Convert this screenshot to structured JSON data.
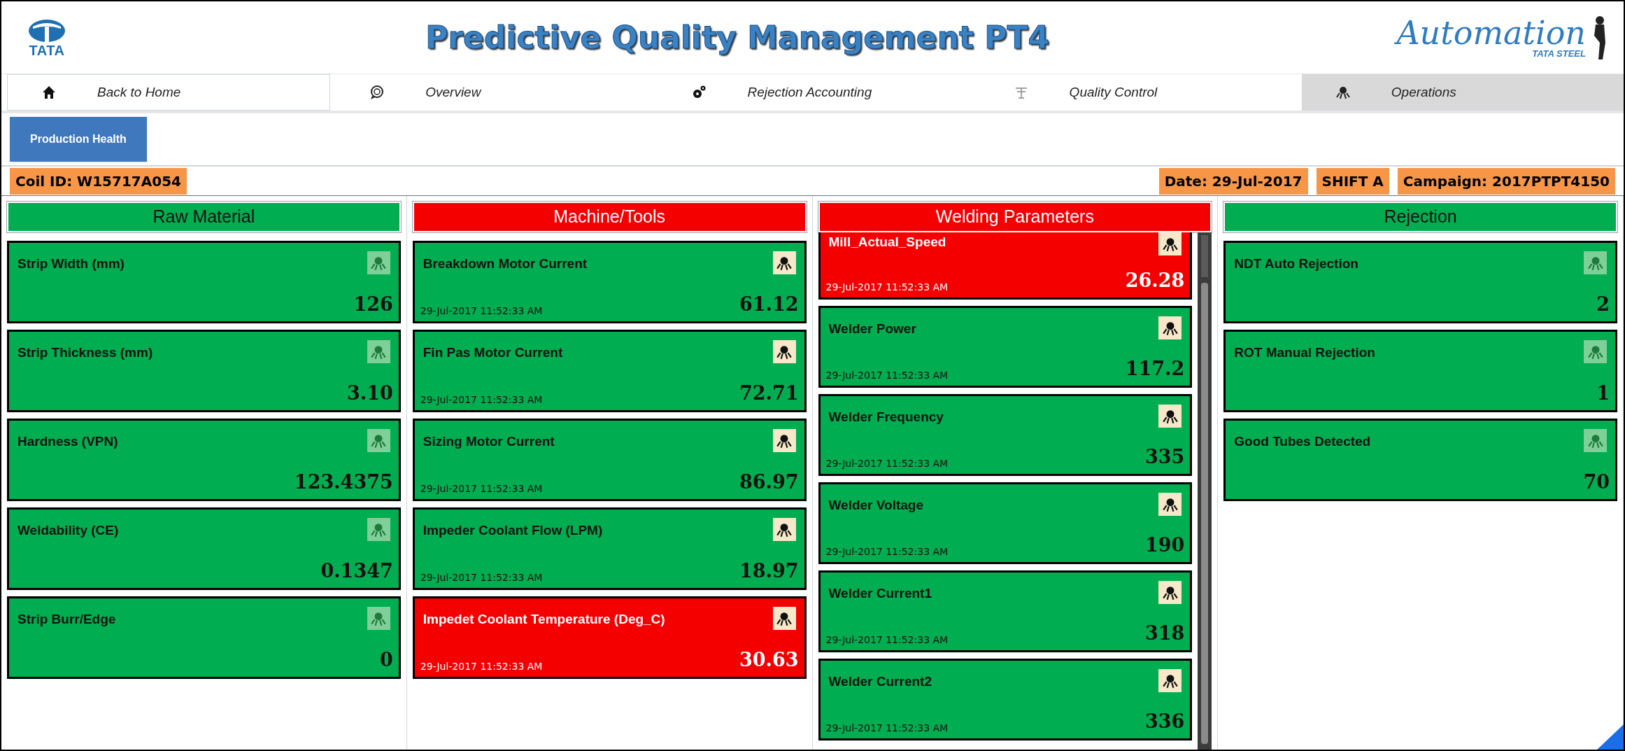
{
  "header": {
    "left_logo": "TATA",
    "title": "Predictive Quality Management PT4",
    "right_logo": "Automation",
    "right_logo_sub": "TATA STEEL"
  },
  "nav": [
    {
      "label": "Back to Home",
      "selected": false,
      "boxed": true
    },
    {
      "label": "Overview",
      "selected": false,
      "boxed": false
    },
    {
      "label": "Rejection Accounting",
      "selected": false,
      "boxed": false
    },
    {
      "label": "Quality Control",
      "selected": false,
      "boxed": false
    },
    {
      "label": "Operations",
      "selected": true,
      "boxed": false
    }
  ],
  "page_button": "Production Health",
  "info_left": [
    "Coil ID: W15717A054"
  ],
  "info_right": [
    "Date: 29-Jul-2017",
    "SHIFT A",
    "Campaign: 2017PTPT4150"
  ],
  "columns": [
    {
      "title": "Raw Material",
      "alarm": false,
      "icon_active": false,
      "scrollable": false,
      "cards": [
        {
          "label": "Strip Width (mm)",
          "value": "126",
          "alarm": false
        },
        {
          "label": "Strip Thickness (mm)",
          "value": "3.10",
          "alarm": false
        },
        {
          "label": "Hardness (VPN)",
          "value": "123.4375",
          "alarm": false
        },
        {
          "label": "Weldability (CE)",
          "value": "0.1347",
          "alarm": false
        },
        {
          "label": "Strip Burr/Edge",
          "value": "0",
          "alarm": false
        }
      ]
    },
    {
      "title": "Machine/Tools",
      "alarm": true,
      "icon_active": true,
      "scrollable": false,
      "cards": [
        {
          "label": "Breakdown Motor Current",
          "time": "29-Jul-2017 11:52:33 AM",
          "value": "61.12",
          "alarm": false
        },
        {
          "label": "Fin Pas Motor Current",
          "time": "29-Jul-2017 11:52:33 AM",
          "value": "72.71",
          "alarm": false
        },
        {
          "label": "Sizing Motor Current",
          "time": "29-Jul-2017 11:52:33 AM",
          "value": "86.97",
          "alarm": false
        },
        {
          "label": "Impeder Coolant Flow (LPM)",
          "time": "29-Jul-2017 11:52:33 AM",
          "value": "18.97",
          "alarm": false
        },
        {
          "label": "Impedet Coolant Temperature (Deg_C)",
          "time": "29-Jul-2017 11:52:33 AM",
          "value": "30.63",
          "alarm": true
        }
      ]
    },
    {
      "title": "Welding Parameters",
      "alarm": true,
      "icon_active": true,
      "scrollable": true,
      "cards": [
        {
          "label": "Mill_Actual_Speed",
          "time": "29-Jul-2017 11:52:33 AM",
          "value": "26.28",
          "alarm": true
        },
        {
          "label": "Welder Power",
          "time": "29-Jul-2017 11:52:33 AM",
          "value": "117.2",
          "alarm": false
        },
        {
          "label": "Welder Frequency",
          "time": "29-Jul-2017 11:52:33 AM",
          "value": "335",
          "alarm": false
        },
        {
          "label": "Welder Voltage",
          "time": "29-Jul-2017 11:52:33 AM",
          "value": "190",
          "alarm": false
        },
        {
          "label": "Welder Current1",
          "time": "29-Jul-2017 11:52:33 AM",
          "value": "318",
          "alarm": false
        },
        {
          "label": "Welder Current2",
          "time": "29-Jul-2017 11:52:33 AM",
          "value": "336",
          "alarm": false
        }
      ]
    },
    {
      "title": "Rejection",
      "alarm": false,
      "icon_active": false,
      "scrollable": false,
      "cards": [
        {
          "label": "NDT Auto Rejection",
          "value": "2",
          "alarm": false
        },
        {
          "label": "ROT Manual Rejection",
          "value": "1",
          "alarm": false
        },
        {
          "label": "Good Tubes Detected",
          "value": "70",
          "alarm": false
        }
      ]
    }
  ]
}
